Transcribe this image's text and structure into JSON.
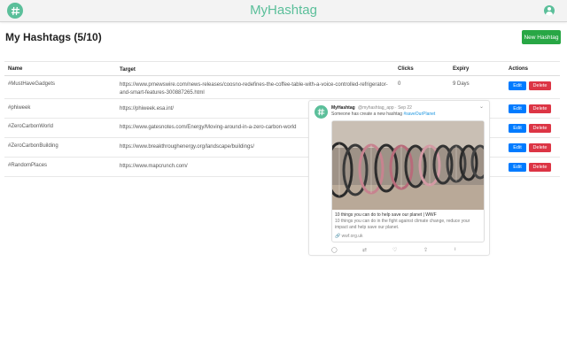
{
  "app": {
    "brand": "MyHashtag"
  },
  "page": {
    "title": "My Hashtags (5/10)",
    "new_button": "New Hashtag"
  },
  "colors": {
    "brand": "#5bbf9a",
    "success": "#28a745",
    "primary": "#007bff",
    "danger": "#dc3545"
  },
  "icons": {
    "logo": "hashtag-logo-icon",
    "user": "user-circle-icon"
  },
  "table": {
    "headers": {
      "name": "Name",
      "target": "Target",
      "clicks": "Clicks",
      "expiry": "Expiry",
      "actions": "Actions"
    },
    "edit_label": "Edit",
    "delete_label": "Delete",
    "rows": [
      {
        "name": "#MustHaveGadgets",
        "target": "https://www.prnewswire.com/news-releases/coosno-redefines-the-coffee-table-with-a-voice-controlled-refrigerator-and-smart-features-300887265.html",
        "clicks": "0",
        "expiry": "9 Days"
      },
      {
        "name": "#phiweek",
        "target": "https://phiweek.esa.int/",
        "clicks": "",
        "expiry": ""
      },
      {
        "name": "#ZeroCarbonWorld",
        "target": "https://www.gatesnotes.com/Energy/Moving-around-in-a-zero-carbon-world",
        "clicks": "",
        "expiry": ""
      },
      {
        "name": "#ZeroCarbonBuilding",
        "target": "https://www.breakthroughenergy.org/landscape/buildings/",
        "clicks": "",
        "expiry": ""
      },
      {
        "name": "#RandomPlaces",
        "target": "https://www.mapcrunch.com/",
        "clicks": "",
        "expiry": ""
      }
    ]
  },
  "tweet": {
    "name": "MyHashtag",
    "handle": "@myhashtag_app · Sep 22",
    "text_prefix": "Someone has create a new hashtag",
    "hashtag": "#saveOurPlanet",
    "card_title": "10 things you can do to help save our planet | WWF",
    "card_desc": "10 things you can do in the fight against climate change, reduce your impact and help save our planet.",
    "card_domain": "wwf.org.uk"
  }
}
